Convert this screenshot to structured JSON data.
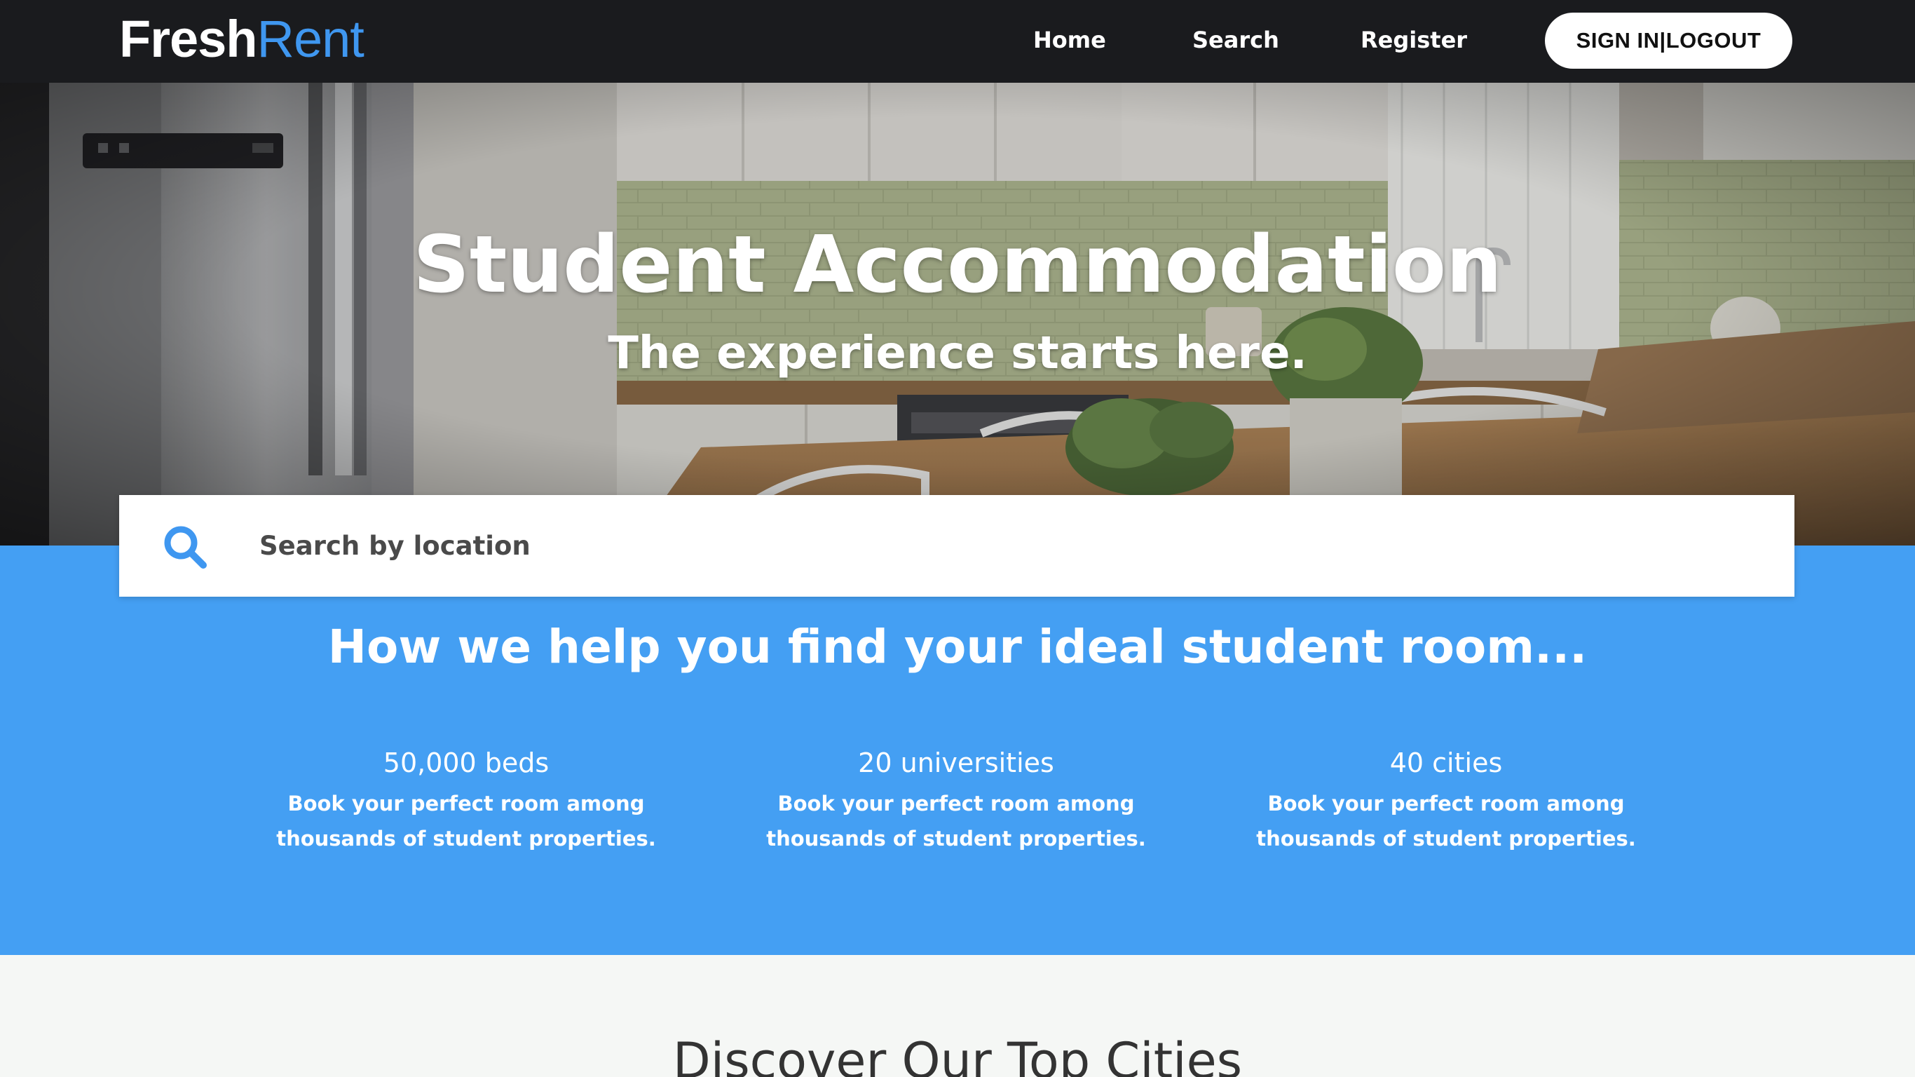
{
  "brand": {
    "logo_part1": "Fresh",
    "logo_part2": "Rent",
    "accent_color": "#3f97f0",
    "nav_bg": "#1a1b1e"
  },
  "nav": {
    "home": "Home",
    "search": "Search",
    "register": "Register",
    "signin": "SIGN IN|LOGOUT"
  },
  "hero": {
    "title": "Student Accommodation",
    "subtitle": "The experience starts here."
  },
  "search": {
    "placeholder": "Search by location",
    "icon": "search-icon"
  },
  "help": {
    "title": "How we help you find your ideal student room...",
    "bg_color": "#449ff3",
    "stats": [
      {
        "value": "50,000 beds",
        "desc": "Book your perfect room among thousands of student properties."
      },
      {
        "value": "20 universities",
        "desc": "Book your perfect room among thousands of student properties."
      },
      {
        "value": "40 cities",
        "desc": "Book your perfect room among thousands of student properties."
      }
    ]
  },
  "discover": {
    "title": "Discover Our Top Cities"
  }
}
